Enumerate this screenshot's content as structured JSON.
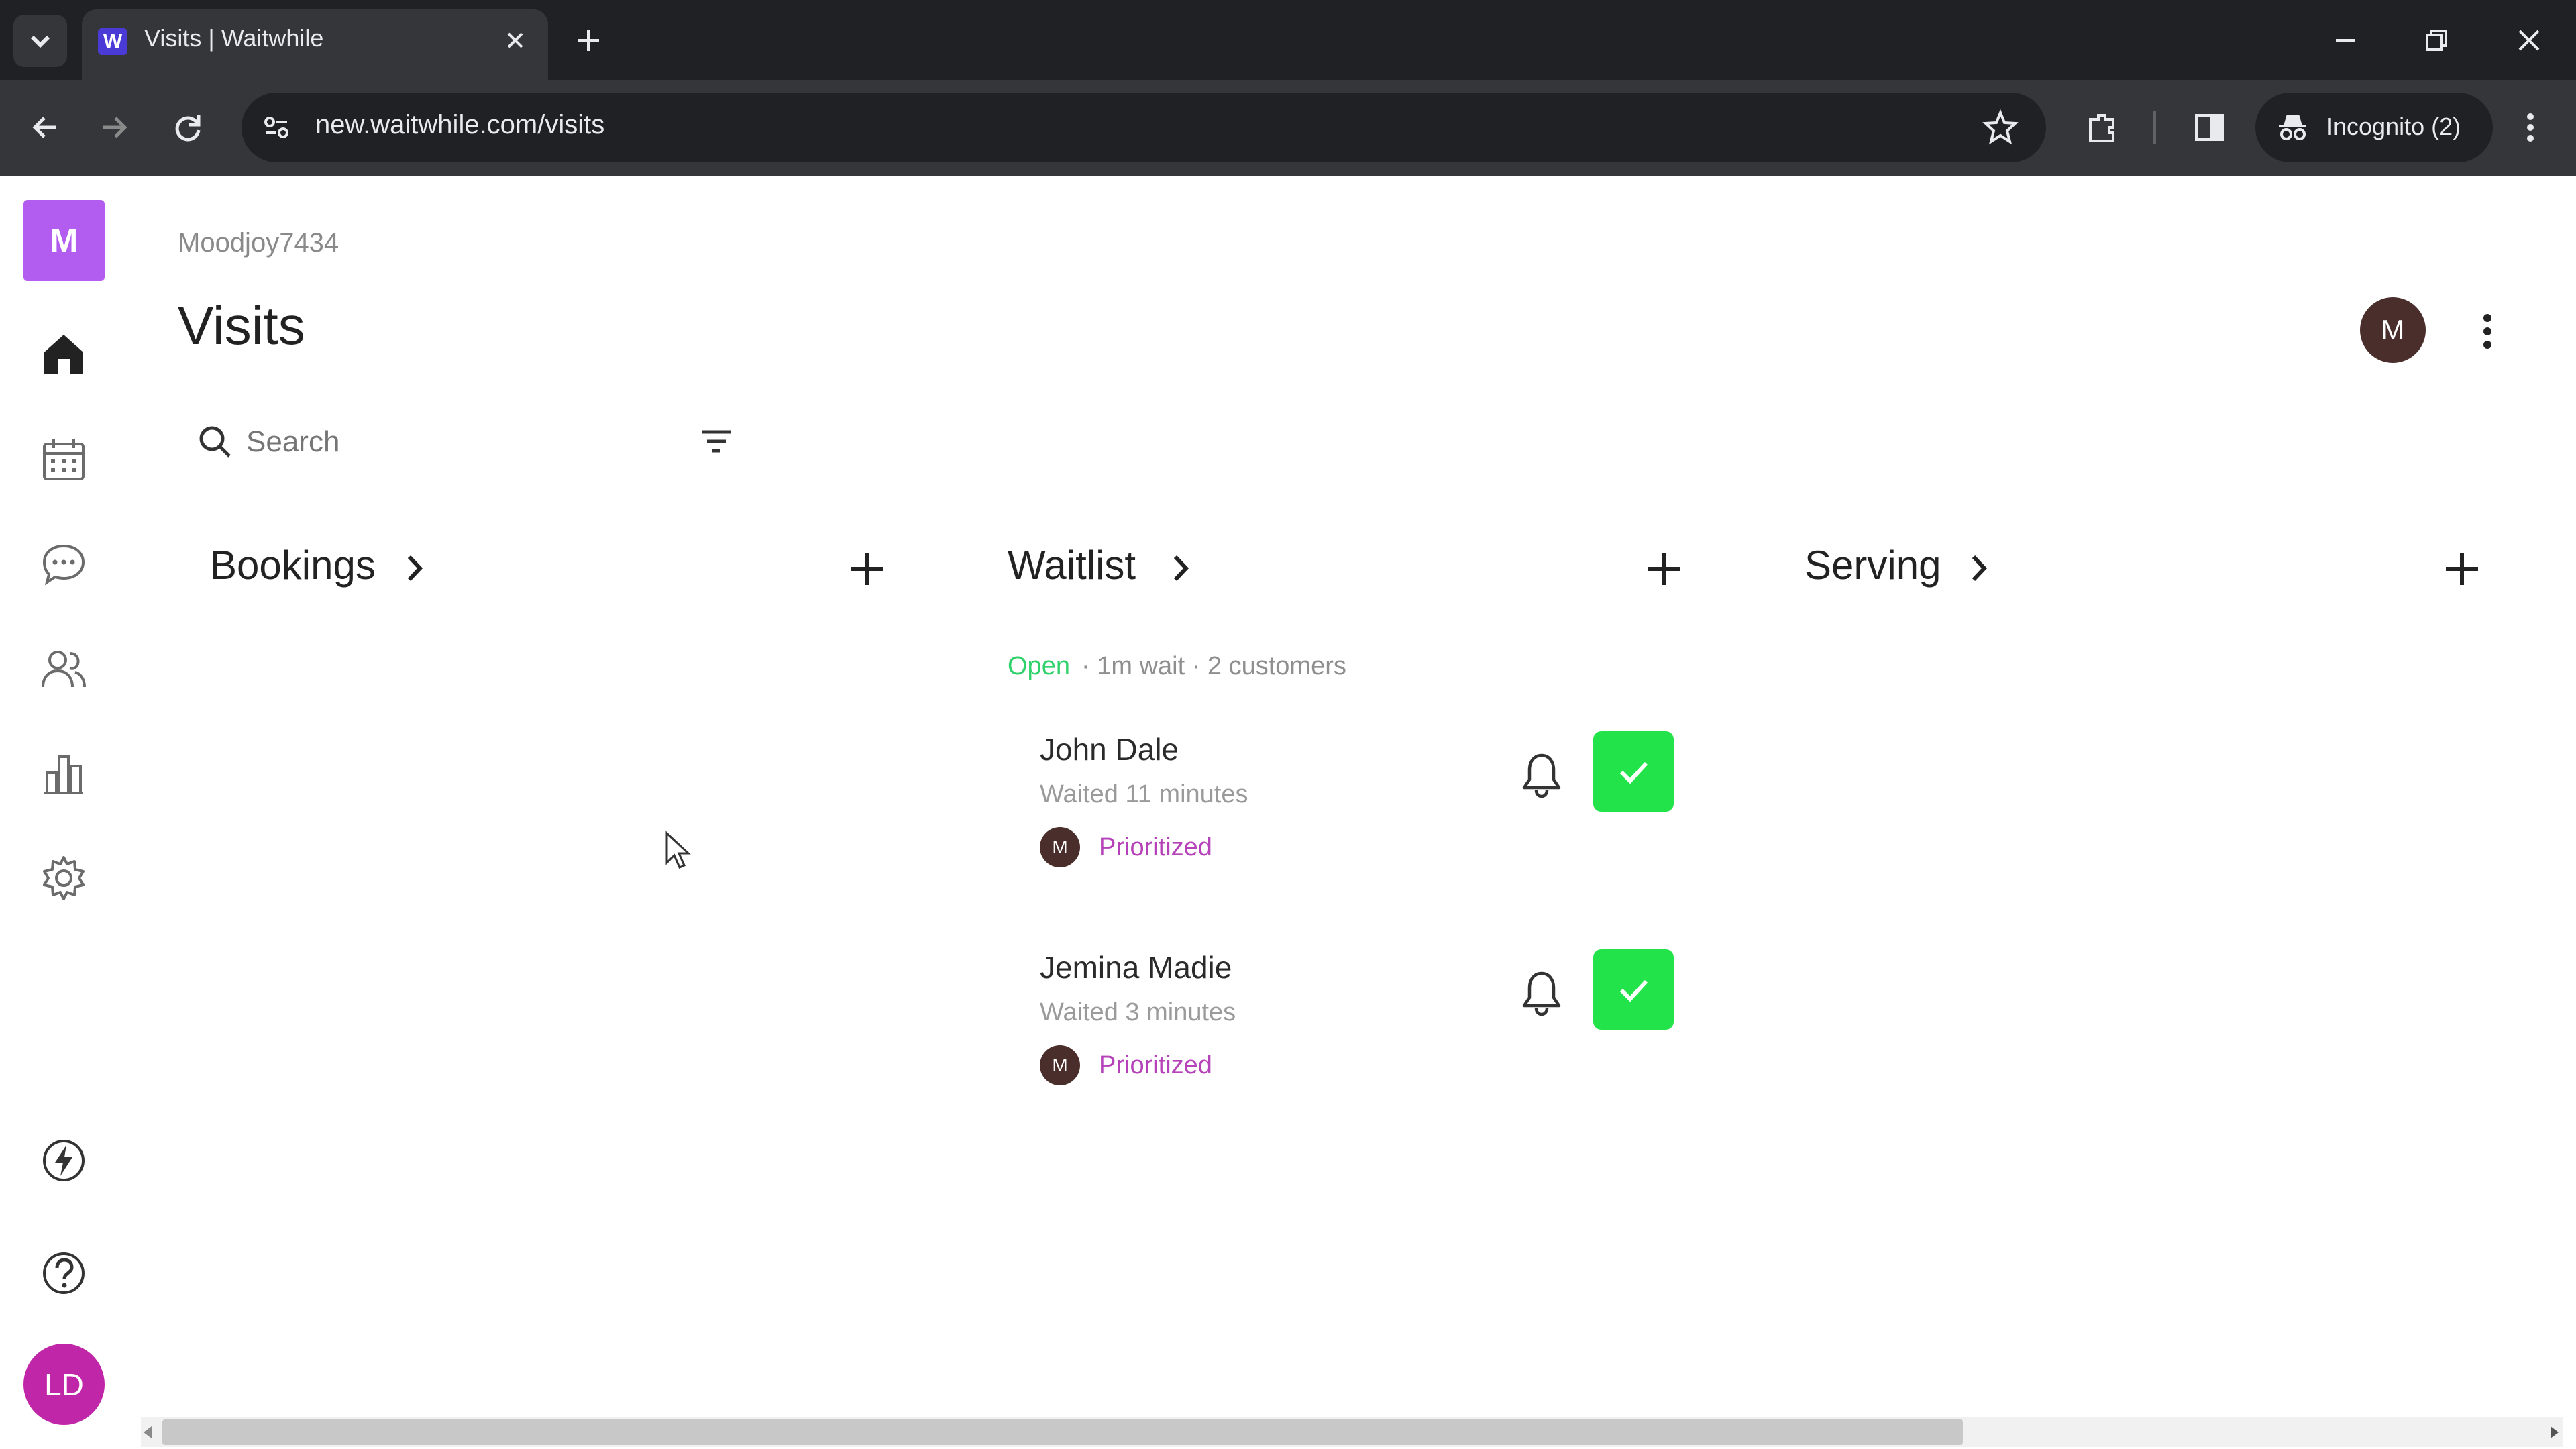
{
  "browser": {
    "tab_title": "Visits | Waitwhile",
    "url": "new.waitwhile.com/visits",
    "incognito_label": "Incognito (2)"
  },
  "sidebar": {
    "logo_letter": "M",
    "user_initials": "LD",
    "items": [
      {
        "icon": "home-icon"
      },
      {
        "icon": "calendar-icon"
      },
      {
        "icon": "chat-icon"
      },
      {
        "icon": "customers-icon"
      },
      {
        "icon": "analytics-icon"
      },
      {
        "icon": "settings-icon"
      }
    ],
    "bottom_icons": [
      "lightning-icon",
      "help-icon"
    ]
  },
  "header": {
    "org_name": "Moodjoy7434",
    "page_title": "Visits",
    "avatar_letter": "M"
  },
  "search": {
    "placeholder": "Search"
  },
  "columns": {
    "bookings": {
      "title": "Bookings"
    },
    "waitlist": {
      "title": "Waitlist",
      "status_open": "Open",
      "status_rest": "· 1m wait · 2 customers"
    },
    "serving": {
      "title": "Serving"
    }
  },
  "waitlist_entries": [
    {
      "name": "John Dale",
      "waited": "Waited 11 minutes",
      "tag_avatar": "M",
      "tag": "Prioritized"
    },
    {
      "name": "Jemina Madie",
      "waited": "Waited 3 minutes",
      "tag_avatar": "M",
      "tag": "Prioritized"
    }
  ],
  "colors": {
    "accent_purple": "#b35cf0",
    "open_green": "#2fd16a",
    "check_green": "#22e34a",
    "prioritized": "#b542b8"
  }
}
